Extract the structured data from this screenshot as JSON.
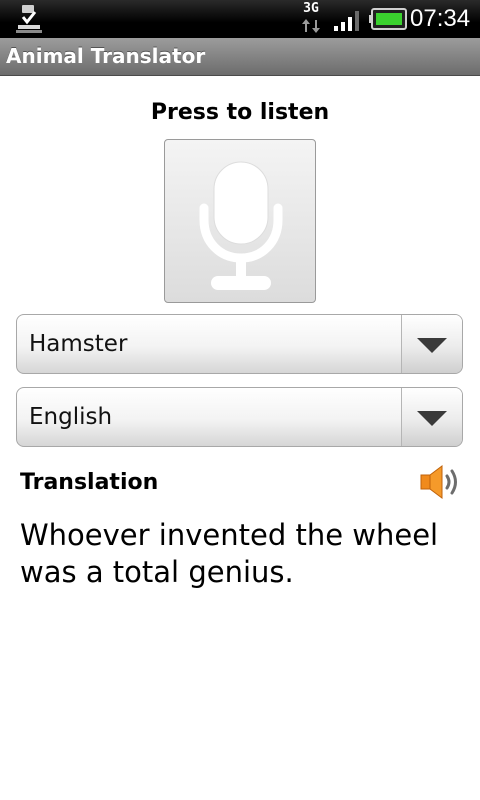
{
  "status_bar": {
    "network_type": "3G",
    "time": "07:34",
    "icons": [
      "download-complete-icon",
      "data-3g-icon",
      "signal-icon",
      "battery-icon"
    ],
    "battery_color": "#3ad12e"
  },
  "app": {
    "title": "Animal Translator"
  },
  "listen": {
    "label": "Press to listen",
    "icon": "microphone-icon"
  },
  "animal_spinner": {
    "selected": "Hamster"
  },
  "language_spinner": {
    "selected": "English"
  },
  "translation": {
    "heading": "Translation",
    "text": "Whoever invented the wheel was a total genius.",
    "speaker_icon": "speaker-icon",
    "speaker_color": "#f08a1c"
  }
}
